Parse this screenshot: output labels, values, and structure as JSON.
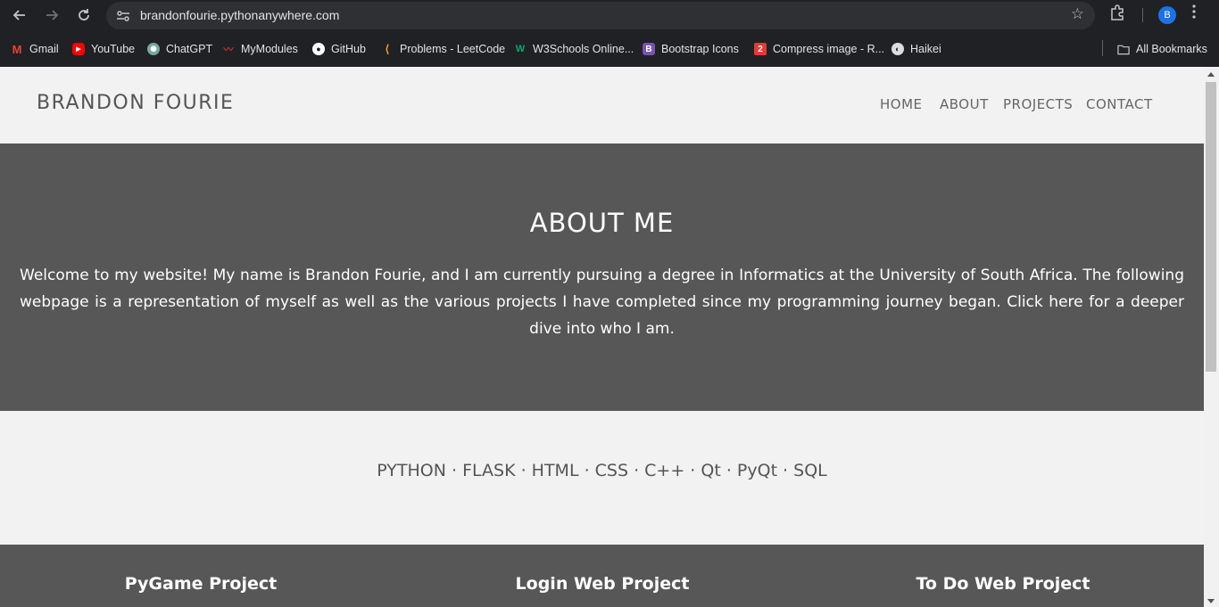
{
  "browser": {
    "url": "brandonfourie.pythonanywhere.com",
    "profile_initial": "B",
    "bookmarks": [
      {
        "label": "Gmail",
        "icon": "gmail-icon",
        "color": "#ea4335"
      },
      {
        "label": "YouTube",
        "icon": "youtube-icon",
        "color": "#ff0000"
      },
      {
        "label": "ChatGPT",
        "icon": "chatgpt-icon",
        "color": "#74aa9c"
      },
      {
        "label": "MyModules",
        "icon": "mymodules-icon",
        "color": "#c0392b"
      },
      {
        "label": "GitHub",
        "icon": "github-icon",
        "color": "#ffffff"
      },
      {
        "label": "Problems - LeetCode",
        "icon": "leetcode-icon",
        "color": "#ffa116"
      },
      {
        "label": "W3Schools Online...",
        "icon": "w3schools-icon",
        "color": "#04aa6d"
      },
      {
        "label": "Bootstrap Icons",
        "icon": "bootstrap-icon",
        "color": "#7952b3"
      },
      {
        "label": "Compress image - R...",
        "icon": "compress-icon",
        "color": "#e53935"
      },
      {
        "label": "Haikei",
        "icon": "haikei-icon",
        "color": "#dddddd"
      }
    ],
    "all_bookmarks": "All Bookmarks"
  },
  "site": {
    "brand": "BRANDON FOURIE",
    "nav": [
      "HOME",
      "ABOUT",
      "PROJECTS",
      "CONTACT"
    ]
  },
  "about": {
    "heading": "ABOUT ME",
    "body": "Welcome to my website! My name is Brandon Fourie, and I am currently pursuing a degree in Informatics at the University of South Africa. The following webpage is a representation of myself as well as the various projects I have completed since my programming journey began. Click here for a deeper dive into who I am."
  },
  "skills": {
    "text": "PYTHON · FLASK · HTML · CSS · C++ · Qt · PyQt · SQL"
  },
  "projects": {
    "titles": [
      "PyGame Project",
      "Login Web Project",
      "To Do Web Project"
    ]
  },
  "colors": {
    "section_dark": "#575757",
    "page_bg": "#f2f2f2",
    "chrome_bg": "#202124"
  }
}
